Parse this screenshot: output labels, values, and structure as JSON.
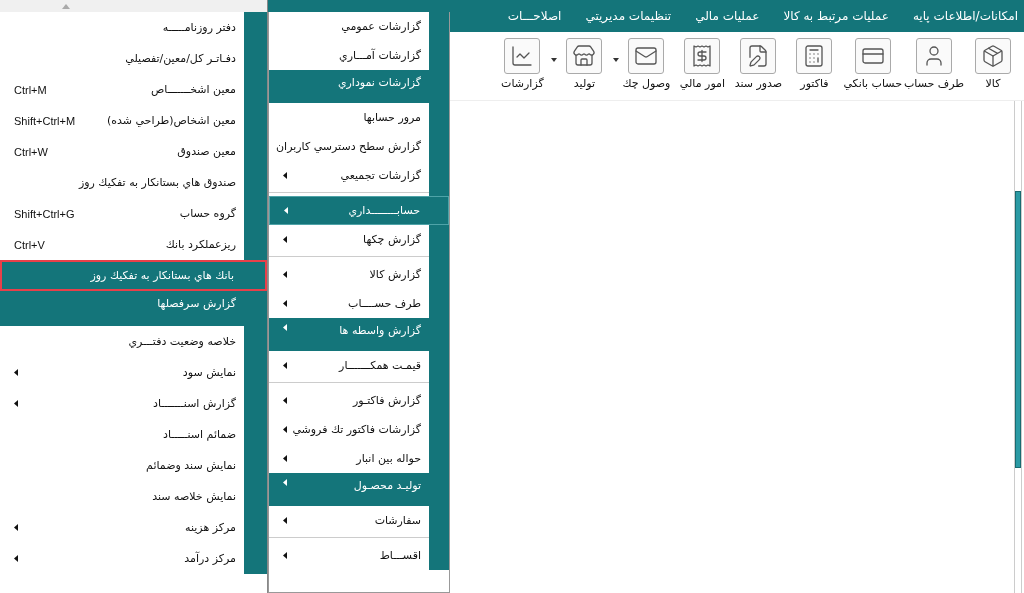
{
  "left_menu": {
    "items": [
      {
        "label": "دفتر روزنامـــــه",
        "kind": "item",
        "submenu": false,
        "selected": false
      },
      {
        "label": "دفـاتـر كل/معين/تفصيلي",
        "kind": "item",
        "submenu": false,
        "selected": false
      },
      {
        "label": "معين اشخـــــــاص",
        "shortcut": "Ctrl+M",
        "kind": "item",
        "submenu": false,
        "selected": false
      },
      {
        "label": "معين اشخاص(طراحي شده)",
        "shortcut": "Shift+Ctrl+M",
        "kind": "item",
        "submenu": false,
        "selected": false
      },
      {
        "label": "معين صندوق",
        "shortcut": "Ctrl+W",
        "kind": "item",
        "submenu": false,
        "selected": false
      },
      {
        "label": "صندوق هاي بستانكار به تفكيك روز",
        "kind": "item",
        "submenu": false,
        "selected": false
      },
      {
        "label": "گروه حساب",
        "shortcut": "Shift+Ctrl+G",
        "kind": "item",
        "submenu": false,
        "selected": false
      },
      {
        "label": "ريزعملكرد بانك",
        "shortcut": "Ctrl+V",
        "kind": "item",
        "submenu": false,
        "selected": false
      },
      {
        "label": "بانك هاي بستانكار به تفكيك روز",
        "kind": "item",
        "submenu": false,
        "selected": true
      },
      {
        "label": "گزارش سرفصلها",
        "kind": "group",
        "submenu": false,
        "selected": false
      },
      {
        "label": "خلاصه وضعيت دفتـــري",
        "kind": "item",
        "submenu": false,
        "selected": false
      },
      {
        "label": "نمايش سود",
        "kind": "item",
        "submenu": true,
        "selected": false
      },
      {
        "label": "گزارش  اسنـــــــاد",
        "kind": "item",
        "submenu": true,
        "selected": false
      },
      {
        "label": "ضمائم اسنـــــاد",
        "kind": "item",
        "submenu": false,
        "selected": false
      },
      {
        "label": "نمايش سند وضمائم",
        "kind": "item",
        "submenu": false,
        "selected": false
      },
      {
        "label": "نمايش خلاصه سند",
        "kind": "item",
        "submenu": false,
        "selected": false
      },
      {
        "label": "مركز هزينه",
        "kind": "item",
        "submenu": true,
        "selected": false
      },
      {
        "label": "مركز درآمد",
        "kind": "item",
        "submenu": true,
        "selected": false
      }
    ]
  },
  "reports_menu": {
    "items": [
      {
        "label": "گزارشات عمومي",
        "kind": "item",
        "submenu": false,
        "selected": false
      },
      {
        "label": "گزارشات آمـــاري",
        "kind": "item",
        "submenu": false,
        "selected": false
      },
      {
        "label": "گزارشات نموداري",
        "kind": "group",
        "submenu": false,
        "selected": false
      },
      {
        "label": "مرور حسابها",
        "kind": "item",
        "submenu": false,
        "selected": false
      },
      {
        "label": "گزارش سطح دسترسي كاربران",
        "kind": "item",
        "submenu": false,
        "selected": false
      },
      {
        "label": "گزارشات تجميعي",
        "kind": "item",
        "submenu": true,
        "selected": false
      },
      {
        "kind": "separator"
      },
      {
        "label": "حسابــــــــداري",
        "kind": "item",
        "submenu": true,
        "selected": true
      },
      {
        "label": "گزارش چكها",
        "kind": "item",
        "submenu": true,
        "selected": false
      },
      {
        "kind": "separator"
      },
      {
        "label": "گزارش كالا",
        "kind": "item",
        "submenu": true,
        "selected": false
      },
      {
        "label": "طرف حســــاب",
        "kind": "item",
        "submenu": true,
        "selected": false
      },
      {
        "label": "گزارش واسطه ها",
        "kind": "group",
        "submenu": true,
        "selected": false
      },
      {
        "label": "قيمـت همكـــــــار",
        "kind": "item",
        "submenu": true,
        "selected": false
      },
      {
        "kind": "separator"
      },
      {
        "label": "گزارش فاكتـور",
        "kind": "item",
        "submenu": true,
        "selected": false
      },
      {
        "label": "گزارشات فاكتور تك فروشي",
        "kind": "item",
        "submenu": true,
        "selected": false
      },
      {
        "label": "حواله بين انبار",
        "kind": "item",
        "submenu": true,
        "selected": false
      },
      {
        "label": "توليـد محصـول",
        "kind": "group",
        "submenu": true,
        "selected": false
      },
      {
        "label": "سفارشات",
        "kind": "item",
        "submenu": true,
        "selected": false
      },
      {
        "kind": "separator"
      },
      {
        "label": "اقســـاط",
        "kind": "item",
        "submenu": true,
        "selected": false
      }
    ]
  },
  "menu_bar": [
    "امكانات/اطلاعات پايه",
    "عمليات مرتبط به كالا",
    "عمليات مالي",
    "تنظيمات مديريتي",
    "اصلاحـــات"
  ],
  "toolbar": [
    {
      "label": "كالا",
      "dropdown": false
    },
    {
      "label": "طرف حساب",
      "dropdown": false
    },
    {
      "label": "حساب بانكي",
      "dropdown": false
    },
    {
      "label": "فاكتور",
      "dropdown": false
    },
    {
      "label": "صدور سند",
      "dropdown": false
    },
    {
      "label": "امور مالي",
      "dropdown": false
    },
    {
      "label": "وصول چك",
      "dropdown": true
    },
    {
      "label": "توليد",
      "dropdown": true
    },
    {
      "label": "گزارشات",
      "dropdown": false
    }
  ]
}
